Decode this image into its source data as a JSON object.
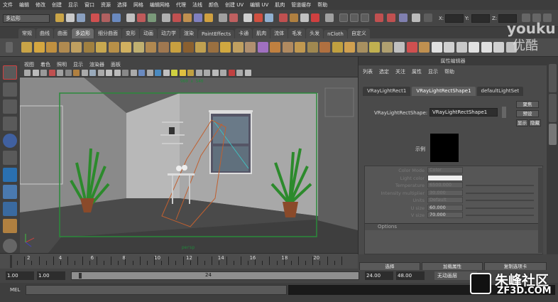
{
  "menubar": [
    "文件",
    "编辑",
    "修改",
    "创建",
    "显示",
    "窗口",
    "资源",
    "选择",
    "网格",
    "编辑网格",
    "代理",
    "法线",
    "颜色",
    "创建 UV",
    "编辑 UV",
    "肌肉",
    "管道缓存",
    "帮助"
  ],
  "status": {
    "mode": "多边形",
    "coord_labels": [
      "X:",
      "Y:",
      "Z:"
    ]
  },
  "shelf_tabs": [
    "常规",
    "曲线",
    "曲面",
    "多边形",
    "细分曲面",
    "变形",
    "动画",
    "动力学",
    "渲染",
    "PaintEffects",
    "卡通",
    "肌肉",
    "流体",
    "毛发",
    "头发",
    "nCloth",
    "自定义"
  ],
  "shelf_active": "多边形",
  "viewport": {
    "menu": [
      "视图",
      "着色",
      "照明",
      "显示",
      "渲染器",
      "面板"
    ],
    "resolution": "960 x 540",
    "camera": "persp"
  },
  "attr": {
    "title": "属性编辑器",
    "menu": [
      "列表",
      "选定",
      "关注",
      "属性",
      "显示",
      "帮助"
    ],
    "tabs": [
      "VRayLightRect1",
      "VRayLightRectShape1",
      "defaultLightSet"
    ],
    "active_tab": "VRayLightRectShape1",
    "shape_label": "VRayLightRectShape:",
    "shape_value": "VRayLightRectShape1",
    "buttons": [
      "聚焦",
      "预设",
      "显示",
      "隐藏"
    ],
    "sample_label": "示例",
    "rows": [
      {
        "label": "Color Mode",
        "value": "Color"
      },
      {
        "label": "Light color",
        "value": ""
      },
      {
        "label": "Temperature",
        "value": "6500.000"
      },
      {
        "label": "Intensity multiplier",
        "value": "30.000"
      },
      {
        "label": "Units",
        "value": "Default"
      },
      {
        "label": "U size",
        "value": "60.000"
      },
      {
        "label": "V size",
        "value": "70.000"
      }
    ],
    "section": "Options"
  },
  "timeline": {
    "ticks": [
      "2",
      "4",
      "6",
      "8",
      "10",
      "12",
      "14",
      "16",
      "18",
      "20"
    ],
    "current_frame": "1"
  },
  "range": {
    "start": "1.00",
    "inner_start": "1.00",
    "inner_end": "24",
    "end1": "24.00",
    "end2": "48.00",
    "anim_layer": "无动画层"
  },
  "bottom_buttons": [
    "选择",
    "加载属性",
    "复制选项卡"
  ],
  "mel_label": "MEL",
  "watermark": {
    "youku_en": "youku",
    "youku_cn": "优酷",
    "site": "朱峰社区",
    "site_url": "ZF3D.COM"
  },
  "colors": {
    "bg": "#444444",
    "viewport_bg": "#5f5f5f",
    "frame_green": "#2a8a3a",
    "accent": "#6a6a6a"
  }
}
